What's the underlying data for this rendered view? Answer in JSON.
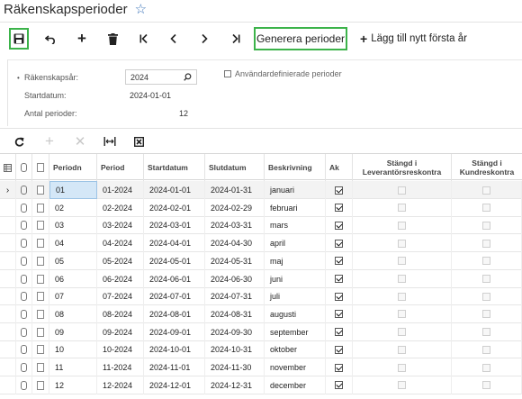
{
  "header": {
    "title": "Räkenskapsperioder",
    "favorite_icon": "star-icon"
  },
  "toolbar": {
    "save_icon": "save-icon",
    "undo_icon": "undo-icon",
    "add_icon": "plus-icon",
    "delete_icon": "trash-icon",
    "first_icon": "first-record-icon",
    "prev_icon": "prev-record-icon",
    "next_icon": "next-record-icon",
    "last_icon": "last-record-icon",
    "generate_label": "Generera perioder",
    "add_first_year_label": "Lägg till nytt första år"
  },
  "form": {
    "fiscal_year_label": "Räkenskapsår:",
    "fiscal_year_value": "2024",
    "start_date_label": "Startdatum:",
    "start_date_value": "2024-01-01",
    "num_periods_label": "Antal perioder:",
    "num_periods_value": "12",
    "user_defined_label": "Användardefinierade perioder",
    "user_defined_checked": false
  },
  "grid_toolbar": {
    "refresh_icon": "refresh-icon",
    "add_icon": "plus-icon",
    "delete_icon": "close-icon",
    "fit_icon": "fit-columns-icon",
    "export_icon": "export-excel-icon"
  },
  "grid": {
    "columns": {
      "period_no": "Periodn",
      "period": "Period",
      "start": "Startdatum",
      "end": "Slutdatum",
      "description": "Beskrivning",
      "active": "Ak",
      "closed_ap": "Stängd i Leverantörsreskontra",
      "closed_ar": "Stängd i Kundreskontra"
    },
    "selected_indicator": "›",
    "rows": [
      {
        "no": "01",
        "period": "01-2024",
        "start": "2024-01-01",
        "end": "2024-01-31",
        "desc": "januari",
        "active": true
      },
      {
        "no": "02",
        "period": "02-2024",
        "start": "2024-02-01",
        "end": "2024-02-29",
        "desc": "februari",
        "active": true
      },
      {
        "no": "03",
        "period": "03-2024",
        "start": "2024-03-01",
        "end": "2024-03-31",
        "desc": "mars",
        "active": true
      },
      {
        "no": "04",
        "period": "04-2024",
        "start": "2024-04-01",
        "end": "2024-04-30",
        "desc": "april",
        "active": true
      },
      {
        "no": "05",
        "period": "05-2024",
        "start": "2024-05-01",
        "end": "2024-05-31",
        "desc": "maj",
        "active": true
      },
      {
        "no": "06",
        "period": "06-2024",
        "start": "2024-06-01",
        "end": "2024-06-30",
        "desc": "juni",
        "active": true
      },
      {
        "no": "07",
        "period": "07-2024",
        "start": "2024-07-01",
        "end": "2024-07-31",
        "desc": "juli",
        "active": true
      },
      {
        "no": "08",
        "period": "08-2024",
        "start": "2024-08-01",
        "end": "2024-08-31",
        "desc": "augusti",
        "active": true
      },
      {
        "no": "09",
        "period": "09-2024",
        "start": "2024-09-01",
        "end": "2024-09-30",
        "desc": "september",
        "active": true
      },
      {
        "no": "10",
        "period": "10-2024",
        "start": "2024-10-01",
        "end": "2024-10-31",
        "desc": "oktober",
        "active": true
      },
      {
        "no": "11",
        "period": "11-2024",
        "start": "2024-11-01",
        "end": "2024-11-30",
        "desc": "november",
        "active": true
      },
      {
        "no": "12",
        "period": "12-2024",
        "start": "2024-12-01",
        "end": "2024-12-31",
        "desc": "december",
        "active": true
      }
    ]
  },
  "colors": {
    "highlight_border": "#3cb34a",
    "link_blue": "#3a73b8",
    "selected_cell": "#d4e7f7"
  }
}
